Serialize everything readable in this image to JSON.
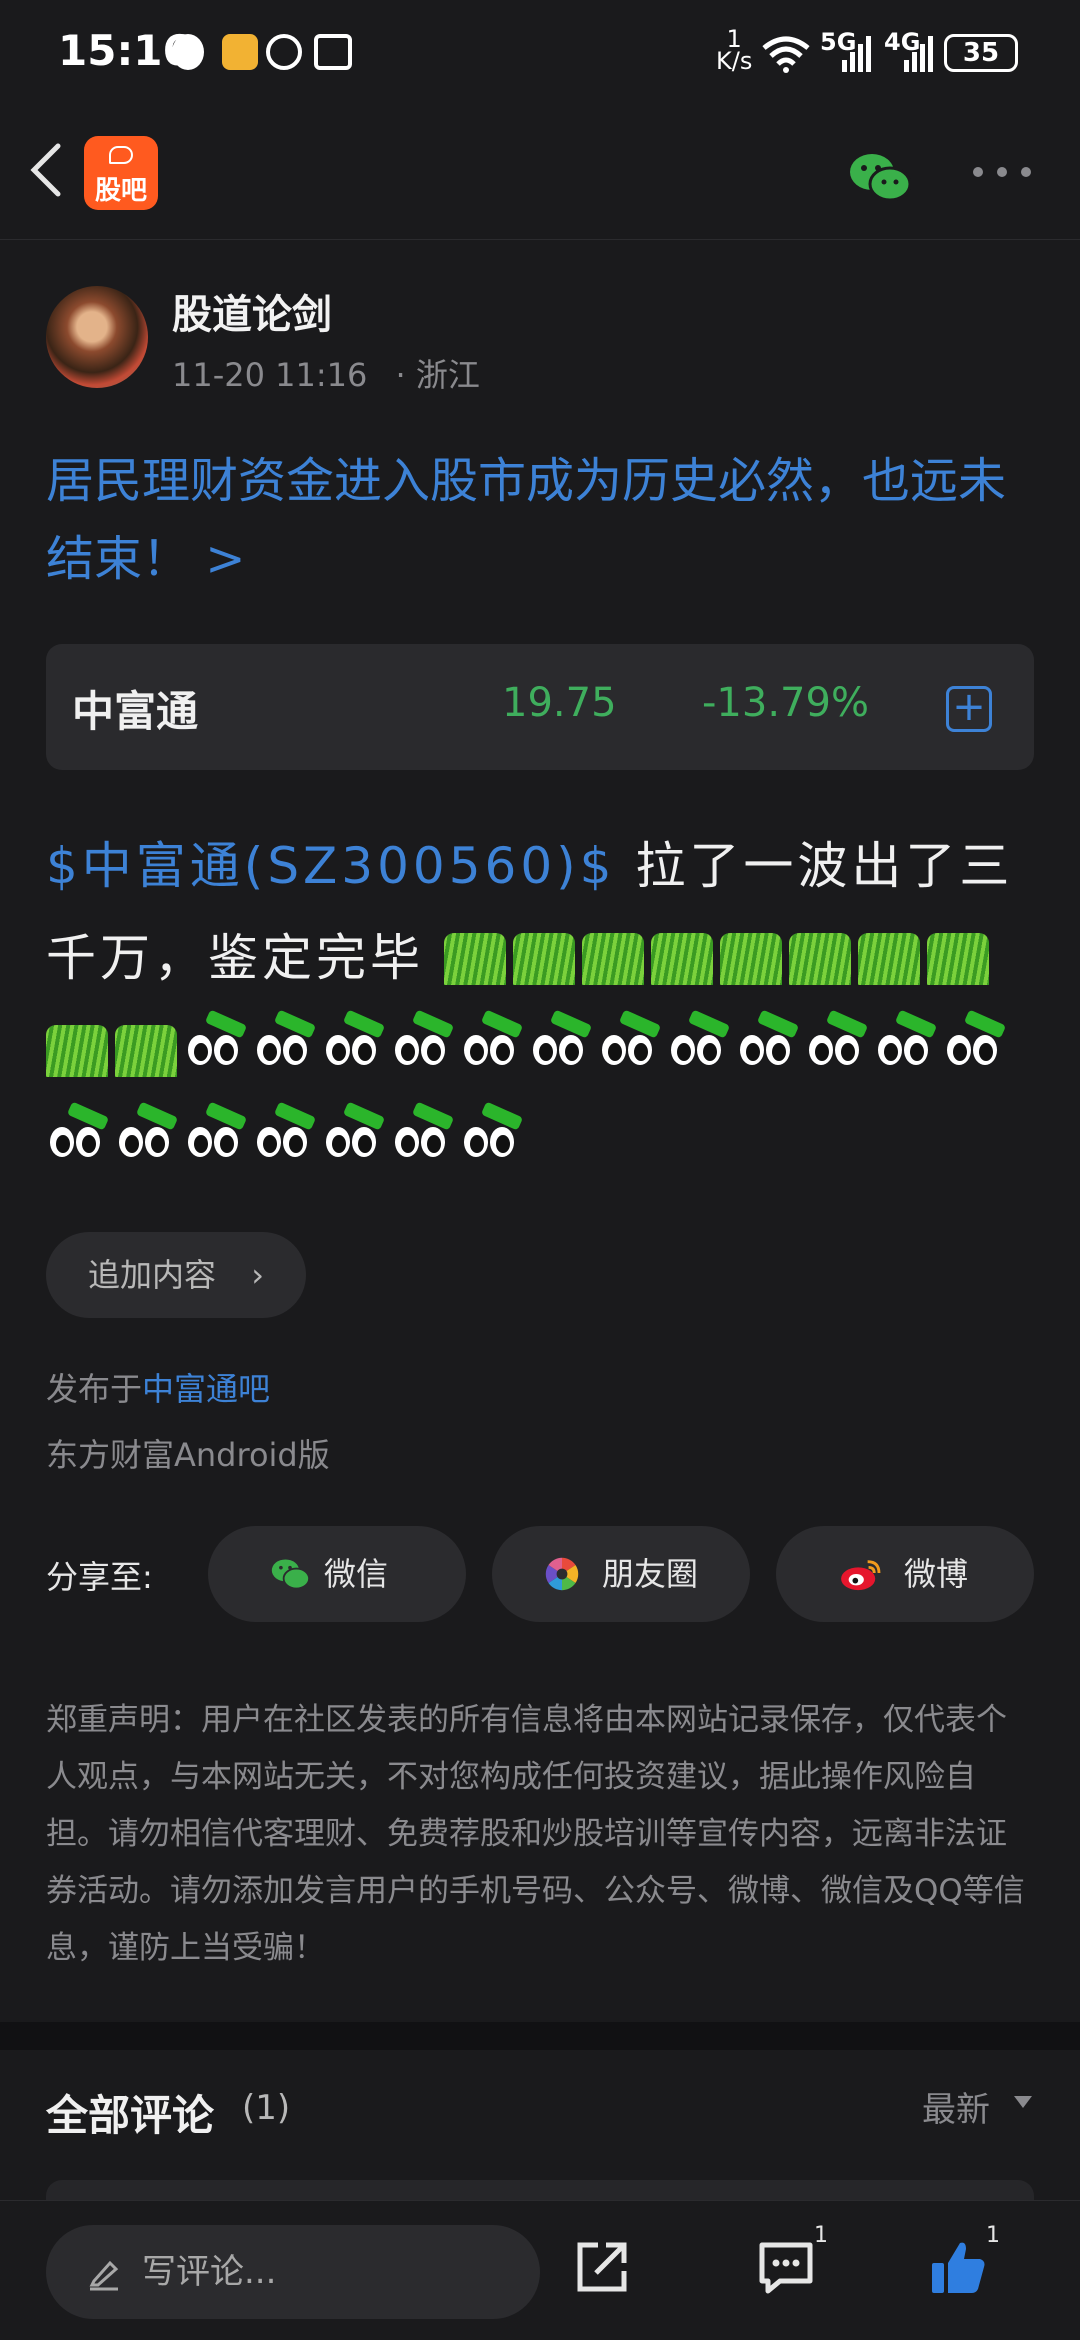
{
  "status": {
    "time": "15:16",
    "net_speed_top": "1",
    "net_speed_unit": "K/s",
    "sig1": "5G",
    "sig2": "4G",
    "battery": "35"
  },
  "header": {
    "logo_text": "股吧"
  },
  "author": {
    "name": "股道论剑",
    "time": "11-20 11:16",
    "location": "· 浙江"
  },
  "post": {
    "title": "居民理财资金进入股市成为历史必然，也远未结束！ >",
    "stock_tag": "$中富通(SZ300560)$",
    "body_text": " 拉了一波出了三千万，鉴定完毕",
    "grass_count": 10,
    "eyes_count": 19
  },
  "stock_card": {
    "name": "中富通",
    "price": "19.75",
    "change": "-13.79%",
    "add_symbol": "+"
  },
  "actions": {
    "add_content": "追加内容",
    "chevron": "›"
  },
  "publish": {
    "prefix": "发布于",
    "bar_name": "中富通吧",
    "client": "东方财富Android版"
  },
  "share": {
    "label": "分享至:",
    "wechat": "微信",
    "moments": "朋友圈",
    "weibo": "微博"
  },
  "disclaimer": "郑重声明：用户在社区发表的所有信息将由本网站记录保存，仅代表个人观点，与本网站无关，不对您构成任何投资建议，据此操作风险自担。请勿相信代客理财、免费荐股和炒股培训等宣传内容，远离非法证券活动。请勿添加发言用户的手机号码、公众号、微博、微信及QQ等信息，谨防上当受骗！",
  "comments": {
    "title": "全部评论",
    "count": "(1)",
    "sort": "最新"
  },
  "bottom": {
    "placeholder": "写评论...",
    "comment_badge": "1",
    "like_badge": "1"
  },
  "colors": {
    "accent_blue": "#3d82d6",
    "down_green": "#3fae5d",
    "brand_orange": "#ff5a1f"
  }
}
